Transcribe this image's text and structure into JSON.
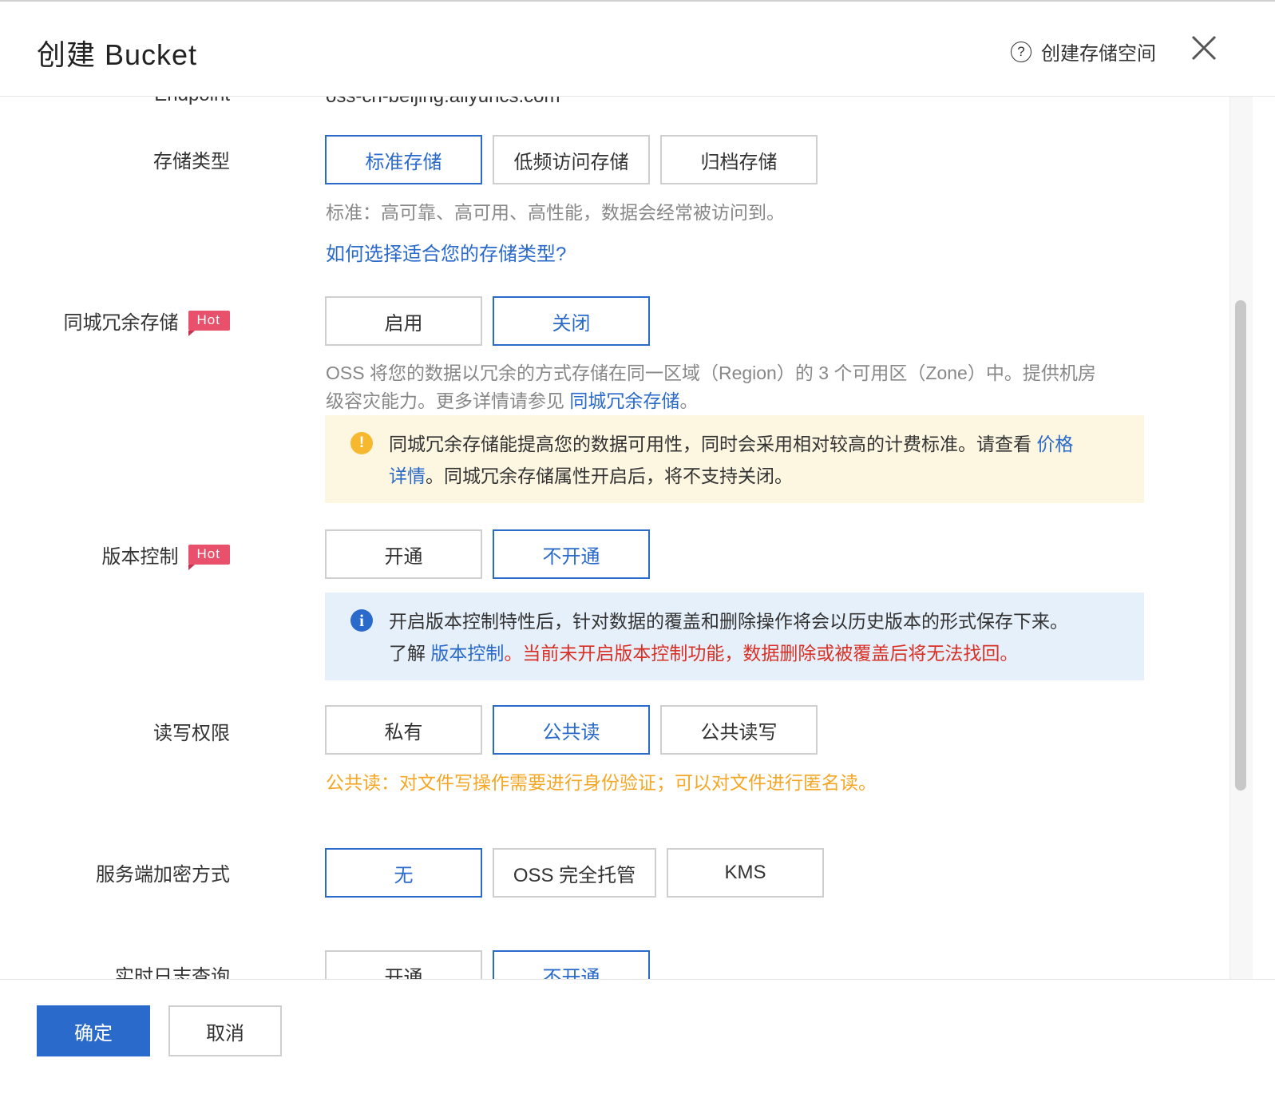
{
  "header": {
    "title": "创建 Bucket",
    "help_icon": "?",
    "help_link": "创建存储空间",
    "close_icon": "close-icon"
  },
  "endpoint": {
    "label": "Endpoint",
    "value": "oss-cn-beijing.aliyuncs.com"
  },
  "storage_class": {
    "label": "存储类型",
    "options": [
      "标准存储",
      "低频访问存储",
      "归档存储"
    ],
    "selected": "标准存储",
    "hint": "标准：高可靠、高可用、高性能，数据会经常被访问到。",
    "help_link": "如何选择适合您的存储类型?"
  },
  "zone_redundancy": {
    "label": "同城冗余存储",
    "badge": "Hot",
    "options": [
      "启用",
      "关闭"
    ],
    "selected": "关闭",
    "hint_line1": "OSS 将您的数据以冗余的方式存储在同一区域（Region）的 3 个可用区（Zone）中。提供机房",
    "hint_line2_prefix": "级容灾能力。更多详情请参见 ",
    "hint_link": "同城冗余存储",
    "hint_suffix": "。",
    "warning_icon": "!",
    "warning_text": "同城冗余存储能提高您的数据可用性，同时会采用相对较高的计费标准。请查看 ",
    "warning_link_part1": "价格",
    "warning_link_part2": "详情",
    "warning_text_after": "。同城冗余存储属性开启后，将不支持关闭。"
  },
  "versioning": {
    "label": "版本控制",
    "badge": "Hot",
    "options": [
      "开通",
      "不开通"
    ],
    "selected": "不开通",
    "info_icon": "i",
    "info_text": "开启版本控制特性后，针对数据的覆盖和删除操作将会以历史版本的形式保存下来。",
    "info_prefix": "了解 ",
    "info_link": "版本控制",
    "info_warning": "。当前未开启版本控制功能，数据删除或被覆盖后将无法找回。"
  },
  "acl": {
    "label": "读写权限",
    "options": [
      "私有",
      "公共读",
      "公共读写"
    ],
    "selected": "公共读",
    "hint": "公共读：对文件写操作需要进行身份验证；可以对文件进行匿名读。",
    "hint_color": "#f5a623"
  },
  "encryption": {
    "label": "服务端加密方式",
    "options": [
      "无",
      "OSS 完全托管",
      "KMS"
    ],
    "selected": "无"
  },
  "realtime_log": {
    "label": "实时日志查询",
    "options": [
      "开通",
      "不开通"
    ],
    "selected": "不开通"
  },
  "footer": {
    "confirm": "确定",
    "cancel": "取消"
  },
  "colors": {
    "accent": "#2a6acb",
    "hot_badge": "#e8506b",
    "warning_bg": "#fdf6e0",
    "info_bg": "#e6f0fb",
    "danger": "#d93026"
  }
}
